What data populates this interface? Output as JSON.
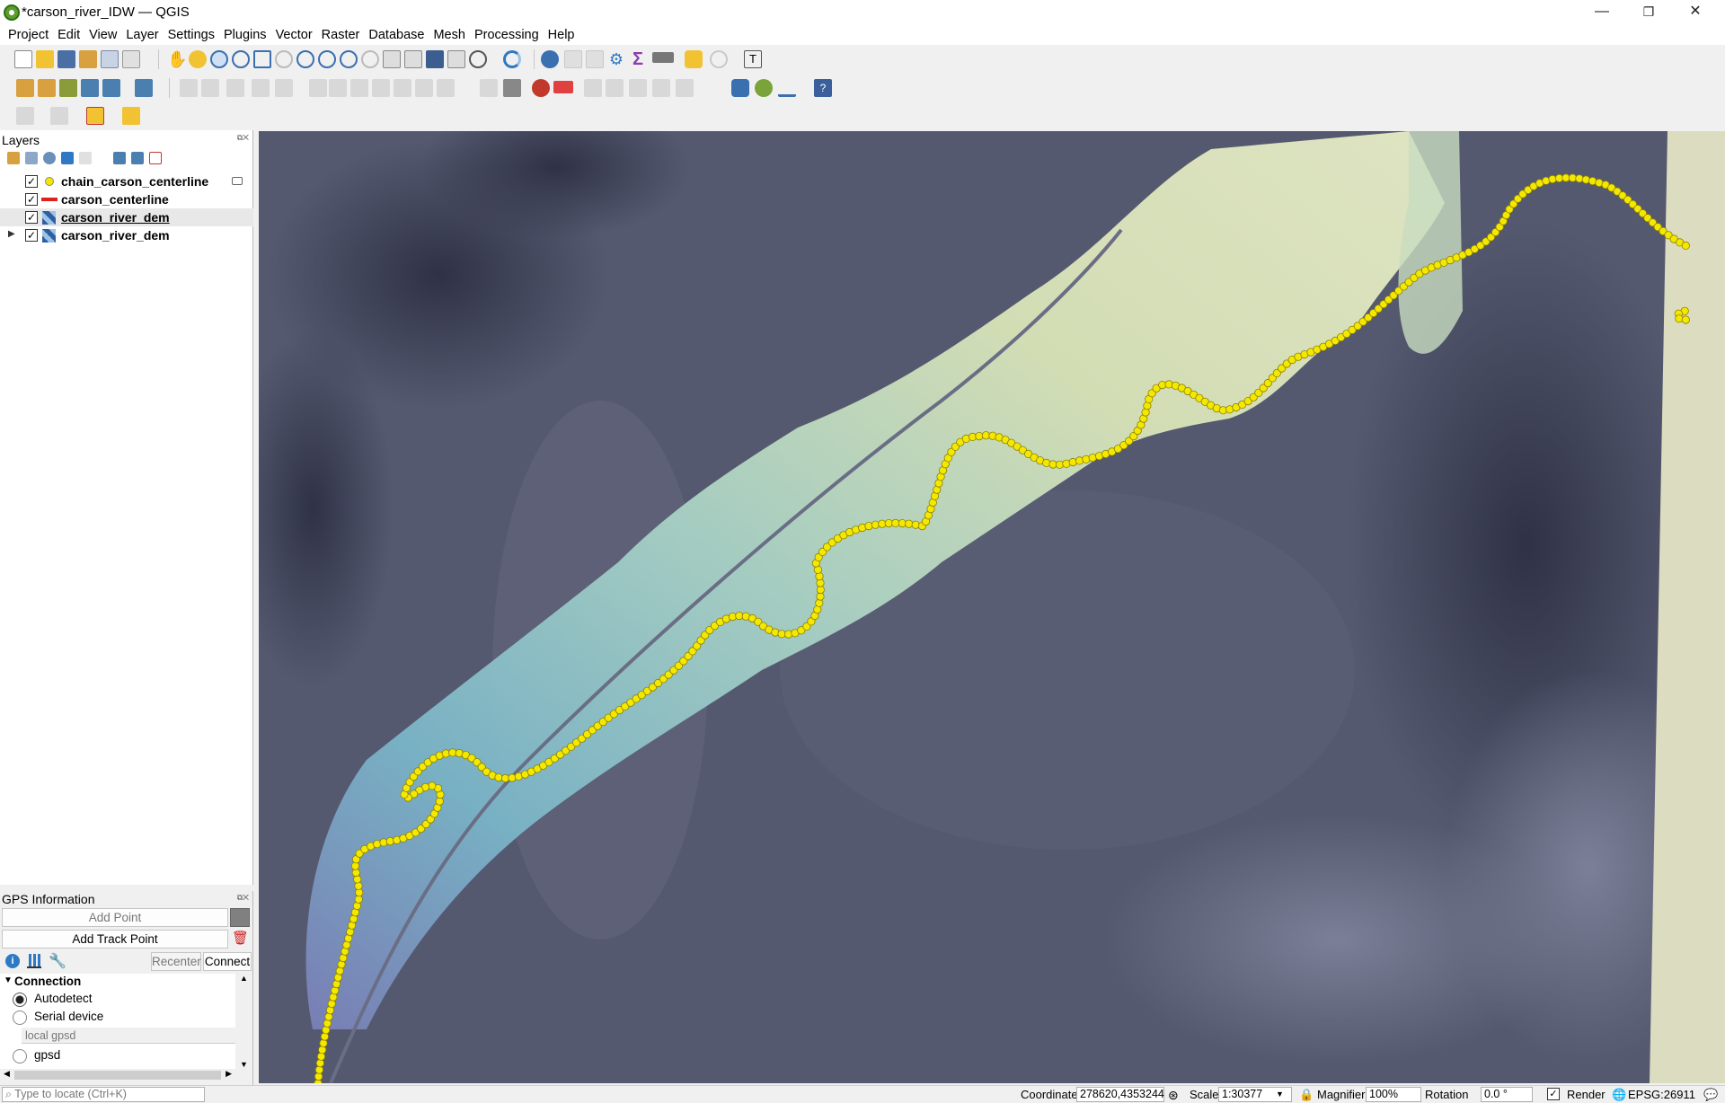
{
  "window": {
    "title": "*carson_river_IDW — QGIS",
    "minimize": "—",
    "maximize": "❐",
    "close": "✕"
  },
  "menu": [
    "Project",
    "Edit",
    "View",
    "Layer",
    "Settings",
    "Plugins",
    "Vector",
    "Raster",
    "Database",
    "Mesh",
    "Processing",
    "Help"
  ],
  "layers_panel": {
    "title": "Layers",
    "layers": [
      {
        "name": "chain_carson_centerline",
        "checked": true,
        "symbol": "yellow-point-icon"
      },
      {
        "name": "carson_centerline",
        "checked": true,
        "symbol": "red-line-icon"
      },
      {
        "name": "carson_river_dem",
        "checked": true,
        "symbol": "raster-icon",
        "selected": true
      },
      {
        "name": "carson_river_dem",
        "checked": true,
        "symbol": "raster-icon",
        "expandable": true
      }
    ]
  },
  "gps_panel": {
    "title": "GPS Information",
    "add_point": "Add Point",
    "add_track_point": "Add Track Point",
    "recenter": "Recenter",
    "connect": "Connect",
    "connection_header": "Connection",
    "options": [
      "Autodetect",
      "Serial device"
    ],
    "host_placeholder": "local gpsd",
    "option_gpsd": "gpsd"
  },
  "map": {
    "background_color": "#55596f",
    "floodplain_colors": [
      "#7ab5c8",
      "#d9e4b8",
      "#e6ebc6"
    ],
    "point_color": "#f5e800",
    "right_margin_color": "#dcdcc0"
  },
  "statusbar": {
    "locate_placeholder": "Type to locate (Ctrl+K)",
    "coordinate_label": "Coordinate",
    "coordinate_value": "278620,4353244",
    "scale_label": "Scale",
    "scale_value": "1:30377",
    "magnifier_label": "Magnifier",
    "magnifier_value": "100%",
    "rotation_label": "Rotation",
    "rotation_value": "0.0 °",
    "render_label": "Render",
    "crs": "EPSG:26911"
  }
}
